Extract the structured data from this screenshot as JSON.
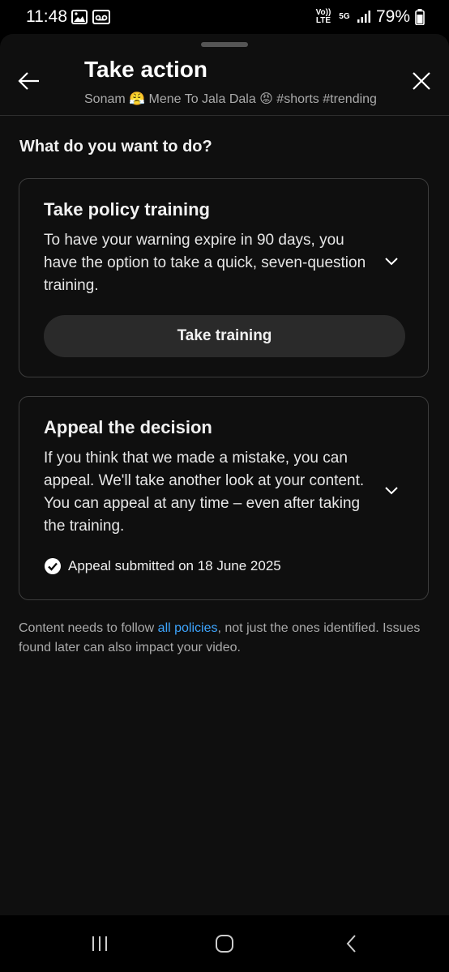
{
  "status_bar": {
    "time": "11:48",
    "battery": "79%",
    "volte_label": "Vo)) LTE",
    "network_label": "5G"
  },
  "header": {
    "title": "Take action",
    "subtitle": "Sonam 😤 Mene To Jala Dala 😡  #shorts #trending"
  },
  "question": "What do you want to do?",
  "options": [
    {
      "title": "Take policy training",
      "description": "To have your warning expire in 90 days, you have the option to take a quick, seven-question training.",
      "button_label": "Take training"
    },
    {
      "title": "Appeal the decision",
      "description": "If you think that we made a mistake, you can appeal. We'll take another look at your content. You can appeal at any time – even after taking the training.",
      "status": "Appeal submitted on 18 June 2025"
    }
  ],
  "footer": {
    "before_link": "Content needs to follow ",
    "link": "all policies",
    "after_link": ", not just the ones identified. Issues found later can also impact your video."
  },
  "colors": {
    "background": "#0f0f0f",
    "link": "#3ea6ff",
    "border": "#3d3d3d",
    "button": "#2a2a2a"
  },
  "icons": [
    "back-arrow-icon",
    "close-icon",
    "chevron-down-icon",
    "check-circle-icon",
    "gallery-icon",
    "voicemail-icon",
    "signal-icon",
    "battery-icon",
    "recents-icon",
    "home-icon",
    "back-nav-icon"
  ]
}
